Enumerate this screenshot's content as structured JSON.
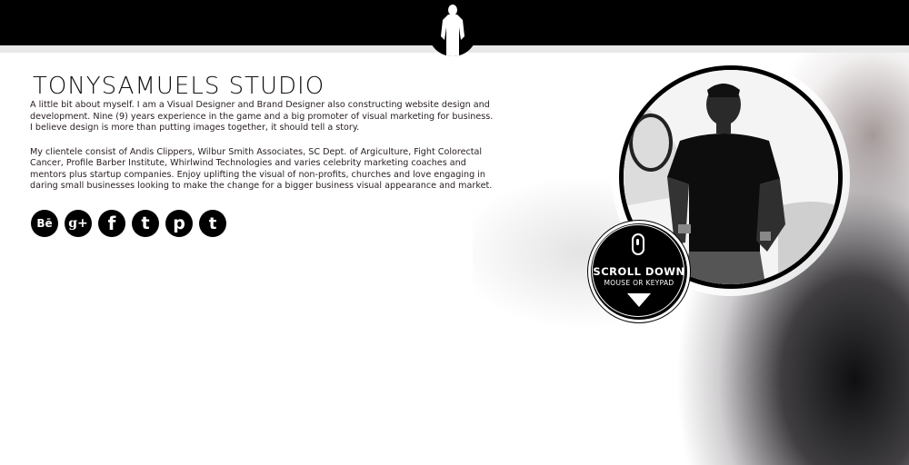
{
  "header": {
    "brand": "TONYSAMUELS STUDIO"
  },
  "bio": {
    "paragraph_1": "A little bit about myself. I am a Visual Designer and Brand Designer also constructing website design and development. Nine (9) years experience in the game and a big promoter of visual marketing for business. I believe design is more than putting images together, it should tell a story.",
    "paragraph_2": "My clientele consist of Andis Clippers, Wilbur Smith Associates, SC Dept. of Argiculture, Fight Colorectal Cancer, Profile Barber Institute, Whirlwind Technologies and varies celebrity marketing coaches and mentors plus startup companies. Enjoy uplifting the visual of non-profits, churches and love engaging in daring small businesses looking to make the change for a bigger business visual appearance and market."
  },
  "socials": [
    {
      "icon": "behance-icon",
      "glyph": "Bē"
    },
    {
      "icon": "google-plus-icon",
      "glyph": "g+"
    },
    {
      "icon": "facebook-icon",
      "glyph": "f"
    },
    {
      "icon": "twitter-icon",
      "glyph": "t"
    },
    {
      "icon": "pinterest-icon",
      "glyph": "p"
    },
    {
      "icon": "tumblr-icon",
      "glyph": "t"
    }
  ],
  "scroll": {
    "title": "SCROLL DOWN",
    "subtitle": "MOUSE OR KEYPAD"
  },
  "colors": {
    "header_bg": "#000000",
    "page_bg": "#ffffff",
    "text": "#2a2024"
  }
}
